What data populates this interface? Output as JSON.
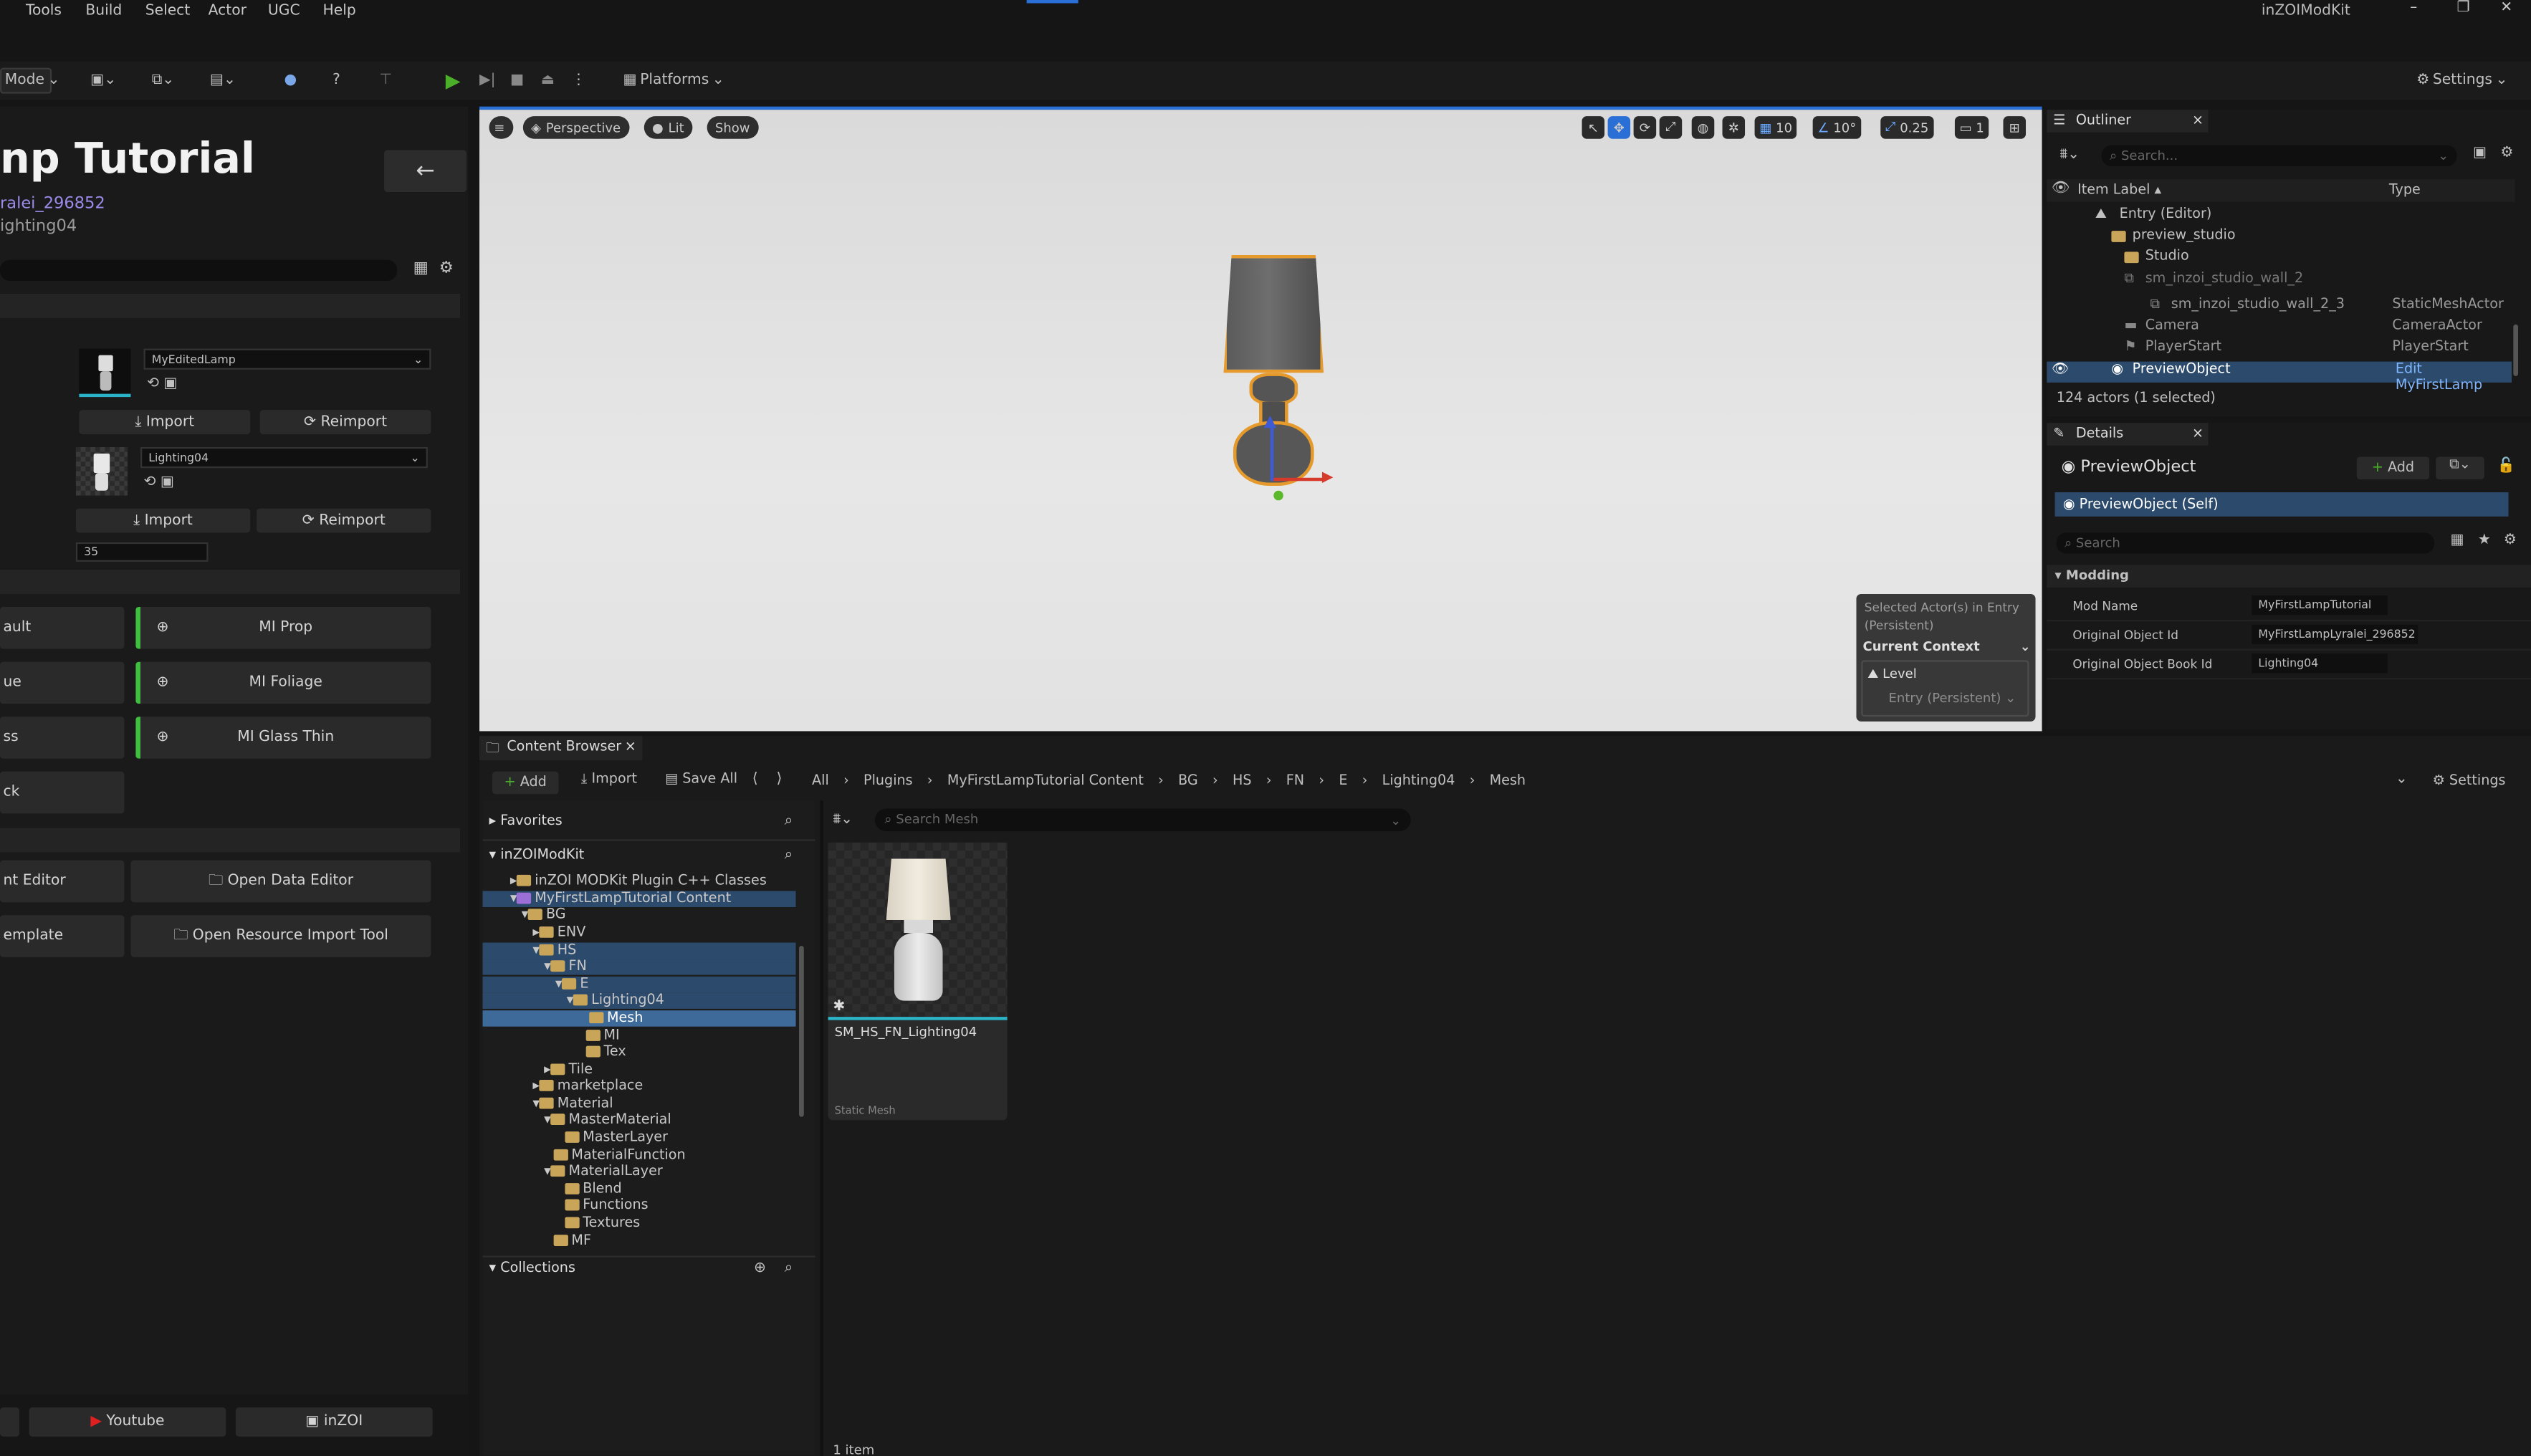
{
  "menu": [
    "Tools",
    "Build",
    "Select",
    "Actor",
    "UGC",
    "Help"
  ],
  "window_title": "inZOIModKit",
  "toolbar": {
    "mode": "Mode",
    "platforms": "Platforms",
    "settings": "Settings"
  },
  "left": {
    "title": "np Tutorial",
    "author": "ralei_296852",
    "book": "ighting04",
    "mesh1": "MyEditedLamp",
    "mesh2": "Lighting04",
    "import": "Import",
    "reimport": "Reimport",
    "num_field": "35",
    "mi_prop": "MI Prop",
    "mi_foliage": "MI Foliage",
    "mi_glass": "MI Glass Thin",
    "left_btns": [
      "ault",
      "ue",
      "ss",
      "ck"
    ],
    "edit_btn": "nt Editor",
    "open_data_editor": "Open Data Editor",
    "template_btn": "emplate",
    "open_resource_tool": "Open Resource Import Tool",
    "youtube": "Youtube",
    "inzoi": "inZOI"
  },
  "viewport": {
    "perspective": "Perspective",
    "lit": "Lit",
    "show": "Show",
    "grid": "10",
    "angle": "10°",
    "scale": "0.25",
    "cam": "1",
    "context_note": "Selected Actor(s) in Entry (Persistent)",
    "current_context": "Current Context",
    "level": "Level",
    "level_value": "Entry (Persistent)"
  },
  "outliner": {
    "tab": "Outliner",
    "search": "Search...",
    "col_label": "Item Label",
    "col_type": "Type",
    "rows": [
      {
        "label": "Entry (Editor)",
        "type": ""
      },
      {
        "label": "preview_studio",
        "type": ""
      },
      {
        "label": "Studio",
        "type": ""
      },
      {
        "label": "sm_inzoi_studio_wall_2",
        "type": ""
      },
      {
        "label": "sm_inzoi_studio_wall_2_3",
        "type": "StaticMeshActor"
      },
      {
        "label": "Camera",
        "type": "CameraActor"
      },
      {
        "label": "PlayerStart",
        "type": "PlayerStart"
      },
      {
        "label": "PreviewObject",
        "type": "Edit MyFirstLamp"
      }
    ],
    "count": "124 actors (1 selected)"
  },
  "details": {
    "tab": "Details",
    "object": "PreviewObject",
    "add": "Add",
    "self": "PreviewObject (Self)",
    "search": "Search",
    "section": "Modding",
    "fields": [
      {
        "label": "Mod Name",
        "value": "MyFirstLampTutorial"
      },
      {
        "label": "Original Object Id",
        "value": "MyFirstLampLyralei_296852"
      },
      {
        "label": "Original Object Book Id",
        "value": "Lighting04"
      }
    ]
  },
  "content_browser": {
    "tab": "Content Browser",
    "add": "Add",
    "import": "Import",
    "save_all": "Save All",
    "path": [
      "All",
      "Plugins",
      "MyFirstLampTutorial Content",
      "BG",
      "HS",
      "FN",
      "E",
      "Lighting04",
      "Mesh"
    ],
    "settings": "Settings",
    "favorites": "Favorites",
    "root": "inZOIModKit",
    "search": "Search Mesh",
    "tree": [
      "inZOI MODKit Plugin C++ Classes",
      "MyFirstLampTutorial Content",
      "BG",
      "ENV",
      "HS",
      "FN",
      "E",
      "Lighting04",
      "Mesh",
      "MI",
      "Tex",
      "Tile",
      "marketplace",
      "Material",
      "MasterMaterial",
      "MasterLayer",
      "MaterialFunction",
      "MaterialLayer",
      "Blend",
      "Functions",
      "Textures",
      "MF"
    ],
    "collections": "Collections",
    "asset_name": "SM_HS_FN_Lighting04",
    "asset_type": "Static Mesh",
    "item_count": "1 item"
  }
}
